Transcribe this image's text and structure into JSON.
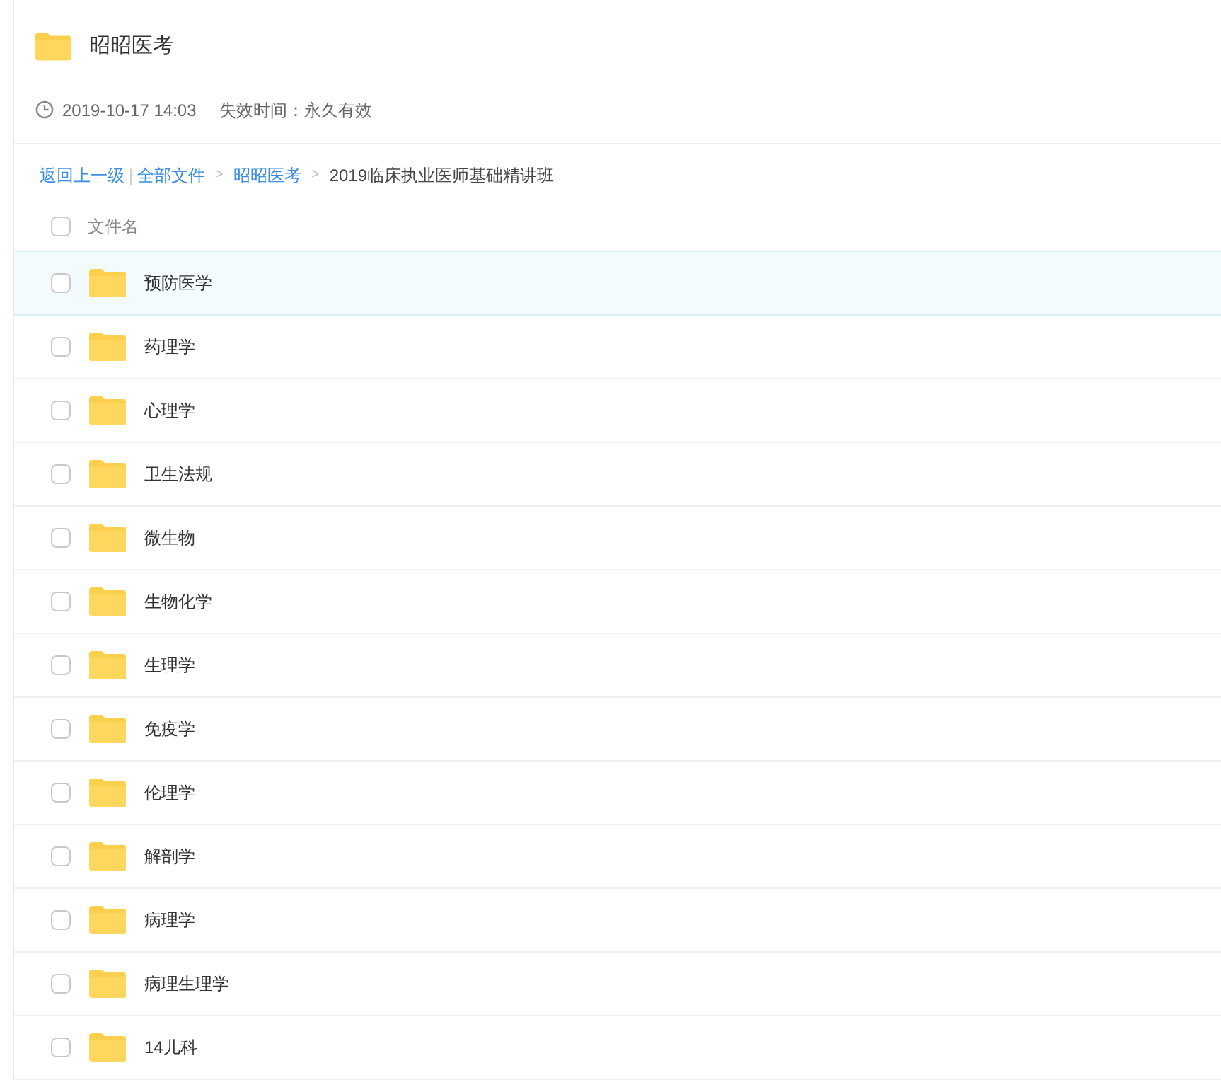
{
  "share": {
    "title": "昭昭医考",
    "date": "2019-10-17 14:03",
    "expiry": "失效时间：永久有效"
  },
  "breadcrumb": {
    "back": "返回上一级",
    "separator": "|",
    "links": [
      "全部文件",
      "昭昭医考"
    ],
    "arrow": ">",
    "current": "2019临床执业医师基础精讲班"
  },
  "list": {
    "header": {
      "label": "文件名",
      "checked": false
    },
    "rows": [
      {
        "name": "预防医学",
        "checked": false,
        "highlighted": true
      },
      {
        "name": "药理学",
        "checked": false,
        "highlighted": false
      },
      {
        "name": "心理学",
        "checked": false,
        "highlighted": false
      },
      {
        "name": "卫生法规",
        "checked": false,
        "highlighted": false
      },
      {
        "name": "微生物",
        "checked": false,
        "highlighted": false
      },
      {
        "name": "生物化学",
        "checked": false,
        "highlighted": false
      },
      {
        "name": "生理学",
        "checked": false,
        "highlighted": false
      },
      {
        "name": "免疫学",
        "checked": false,
        "highlighted": false
      },
      {
        "name": "伦理学",
        "checked": false,
        "highlighted": false
      },
      {
        "name": "解剖学",
        "checked": false,
        "highlighted": false
      },
      {
        "name": "病理学",
        "checked": false,
        "highlighted": false
      },
      {
        "name": "病理生理学",
        "checked": false,
        "highlighted": false
      },
      {
        "name": "14儿科",
        "checked": false,
        "highlighted": false
      }
    ]
  }
}
